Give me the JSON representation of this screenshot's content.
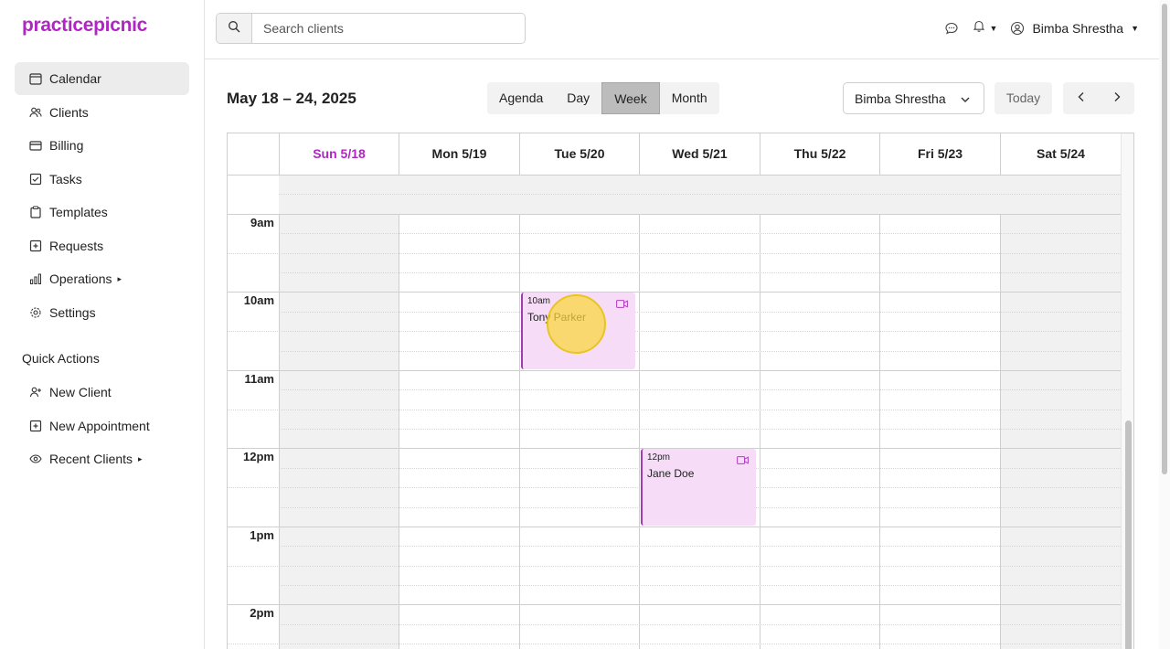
{
  "app": {
    "logo": "practicepicnic"
  },
  "sidebar": {
    "items": [
      {
        "label": "Calendar",
        "icon": "calendar-icon",
        "active": true
      },
      {
        "label": "Clients",
        "icon": "users-icon"
      },
      {
        "label": "Billing",
        "icon": "credit-card-icon"
      },
      {
        "label": "Tasks",
        "icon": "checkbox-icon"
      },
      {
        "label": "Templates",
        "icon": "clipboard-icon"
      },
      {
        "label": "Requests",
        "icon": "plus-square-icon"
      },
      {
        "label": "Operations",
        "icon": "bar-chart-icon",
        "caret": true
      },
      {
        "label": "Settings",
        "icon": "gear-icon"
      }
    ],
    "quick_actions_title": "Quick Actions",
    "quick_actions": [
      {
        "label": "New Client",
        "icon": "user-plus-icon"
      },
      {
        "label": "New Appointment",
        "icon": "plus-square-icon"
      },
      {
        "label": "Recent Clients",
        "icon": "eye-icon",
        "caret": true
      }
    ]
  },
  "header": {
    "search_placeholder": "Search clients",
    "user_name": "Bimba Shrestha"
  },
  "toolbar": {
    "range": "May 18 – 24, 2025",
    "views": [
      "Agenda",
      "Day",
      "Week",
      "Month"
    ],
    "selected_view": "Week",
    "provider": "Bimba Shrestha",
    "today": "Today"
  },
  "calendar": {
    "days": [
      "Sun 5/18",
      "Mon 5/19",
      "Tue 5/20",
      "Wed 5/21",
      "Thu 5/22",
      "Fri 5/23",
      "Sat 5/24"
    ],
    "today_index": 0,
    "hours": [
      "9am",
      "10am",
      "11am",
      "12pm",
      "1pm",
      "2pm"
    ],
    "events": [
      {
        "time": "10am",
        "name": "Tony Parker",
        "day_index": 2
      },
      {
        "time": "12pm",
        "name": "Jane Doe",
        "day_index": 3
      }
    ]
  },
  "colors": {
    "brand": "#b026c3",
    "event_bg": "#f6dcf7",
    "event_border": "#a03cb0"
  }
}
